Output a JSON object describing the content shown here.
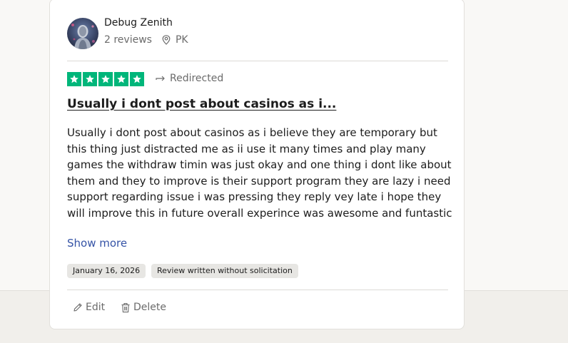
{
  "reviewer": {
    "name": "Debug Zenith",
    "reviews_count": "2 reviews",
    "country": "PK"
  },
  "review": {
    "rating": 5,
    "source": "Redirected",
    "title": "Usually i dont post about casinos as i...",
    "body": "Usually i dont post about casinos as i believe they are temporary but this thing just distracted me as ii use it many times and play many games the withdraw timin was just okay and one thing i dont like about them and they to improve is their support program they are lazy i need support regarding issue i was pressing they reply vey late i hope they will improve this in future overall experince was awesome and funtastic",
    "show_more_label": "Show more",
    "date": "January 16, 2026",
    "solicitation_badge": "Review written without solicitation"
  },
  "actions": {
    "edit_label": "Edit",
    "delete_label": "Delete"
  },
  "colors": {
    "star_green": "#00b67a",
    "link_blue": "#3553a6",
    "muted_text": "#6b6b6b"
  },
  "icons": {
    "location": "map-pin-icon",
    "source": "redirect-arrow-icon",
    "star": "star-icon",
    "edit": "pencil-icon",
    "delete": "trash-icon"
  }
}
